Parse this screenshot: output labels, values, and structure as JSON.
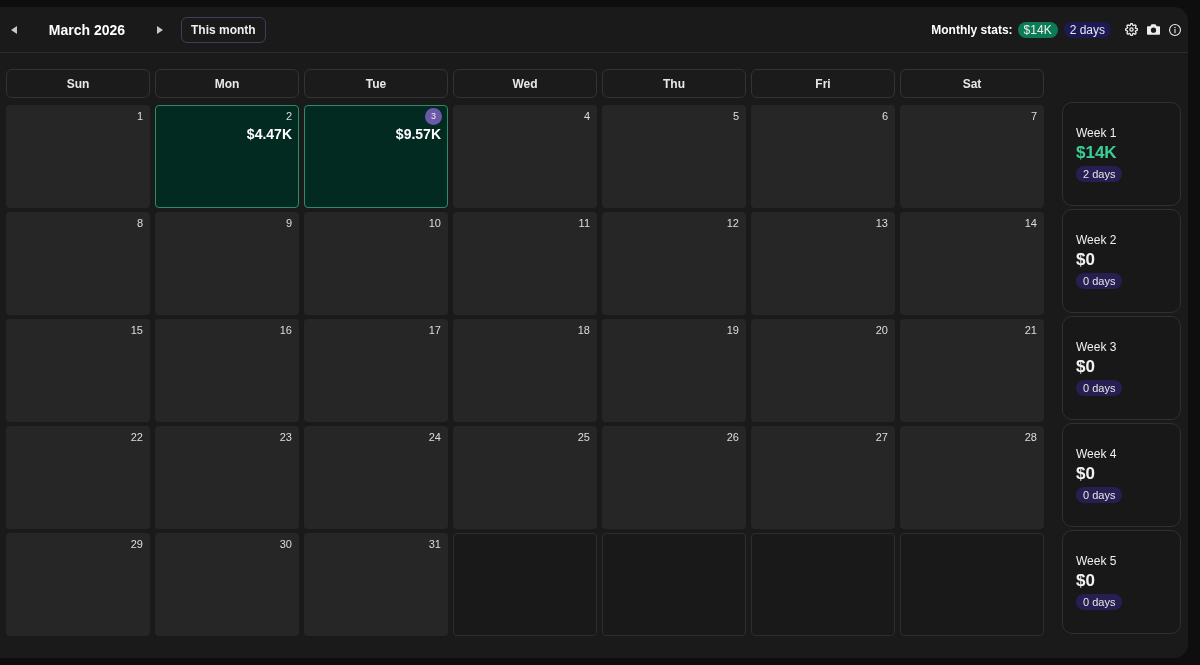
{
  "header": {
    "title": "March 2026",
    "today_button": "This month",
    "stats_label": "Monthly stats:",
    "stats_amount": "$14K",
    "stats_days": "2 days"
  },
  "weekdays": [
    "Sun",
    "Mon",
    "Tue",
    "Wed",
    "Thu",
    "Fri",
    "Sat"
  ],
  "weeks": [
    {
      "days": [
        {
          "kind": "day",
          "date": "1",
          "today": false,
          "profitable": false
        },
        {
          "kind": "day",
          "date": "2",
          "today": false,
          "profitable": true,
          "amount": "$4.47K"
        },
        {
          "kind": "day",
          "date": "3",
          "today": true,
          "profitable": true,
          "amount": "$9.57K"
        },
        {
          "kind": "day",
          "date": "4",
          "today": false,
          "profitable": false
        },
        {
          "kind": "day",
          "date": "5",
          "today": false,
          "profitable": false
        },
        {
          "kind": "day",
          "date": "6",
          "today": false,
          "profitable": false
        },
        {
          "kind": "day",
          "date": "7",
          "today": false,
          "profitable": false
        }
      ],
      "summary": {
        "label": "Week 1",
        "amount": "$14K",
        "days": "2 days",
        "profitable": true
      }
    },
    {
      "days": [
        {
          "kind": "day",
          "date": "8",
          "today": false,
          "profitable": false
        },
        {
          "kind": "day",
          "date": "9",
          "today": false,
          "profitable": false
        },
        {
          "kind": "day",
          "date": "10",
          "today": false,
          "profitable": false
        },
        {
          "kind": "day",
          "date": "11",
          "today": false,
          "profitable": false
        },
        {
          "kind": "day",
          "date": "12",
          "today": false,
          "profitable": false
        },
        {
          "kind": "day",
          "date": "13",
          "today": false,
          "profitable": false
        },
        {
          "kind": "day",
          "date": "14",
          "today": false,
          "profitable": false
        }
      ],
      "summary": {
        "label": "Week 2",
        "amount": "$0",
        "days": "0 days",
        "profitable": false
      }
    },
    {
      "days": [
        {
          "kind": "day",
          "date": "15",
          "today": false,
          "profitable": false
        },
        {
          "kind": "day",
          "date": "16",
          "today": false,
          "profitable": false
        },
        {
          "kind": "day",
          "date": "17",
          "today": false,
          "profitable": false
        },
        {
          "kind": "day",
          "date": "18",
          "today": false,
          "profitable": false
        },
        {
          "kind": "day",
          "date": "19",
          "today": false,
          "profitable": false
        },
        {
          "kind": "day",
          "date": "20",
          "today": false,
          "profitable": false
        },
        {
          "kind": "day",
          "date": "21",
          "today": false,
          "profitable": false
        }
      ],
      "summary": {
        "label": "Week 3",
        "amount": "$0",
        "days": "0 days",
        "profitable": false
      }
    },
    {
      "days": [
        {
          "kind": "day",
          "date": "22",
          "today": false,
          "profitable": false
        },
        {
          "kind": "day",
          "date": "23",
          "today": false,
          "profitable": false
        },
        {
          "kind": "day",
          "date": "24",
          "today": false,
          "profitable": false
        },
        {
          "kind": "day",
          "date": "25",
          "today": false,
          "profitable": false
        },
        {
          "kind": "day",
          "date": "26",
          "today": false,
          "profitable": false
        },
        {
          "kind": "day",
          "date": "27",
          "today": false,
          "profitable": false
        },
        {
          "kind": "day",
          "date": "28",
          "today": false,
          "profitable": false
        }
      ],
      "summary": {
        "label": "Week 4",
        "amount": "$0",
        "days": "0 days",
        "profitable": false
      }
    },
    {
      "days": [
        {
          "kind": "day",
          "date": "29",
          "today": false,
          "profitable": false
        },
        {
          "kind": "day",
          "date": "30",
          "today": false,
          "profitable": false
        },
        {
          "kind": "day",
          "date": "31",
          "today": false,
          "profitable": false
        },
        {
          "kind": "blank"
        },
        {
          "kind": "blank"
        },
        {
          "kind": "blank"
        },
        {
          "kind": "blank"
        }
      ],
      "summary": {
        "label": "Week 5",
        "amount": "$0",
        "days": "0 days",
        "profitable": false
      }
    }
  ]
}
